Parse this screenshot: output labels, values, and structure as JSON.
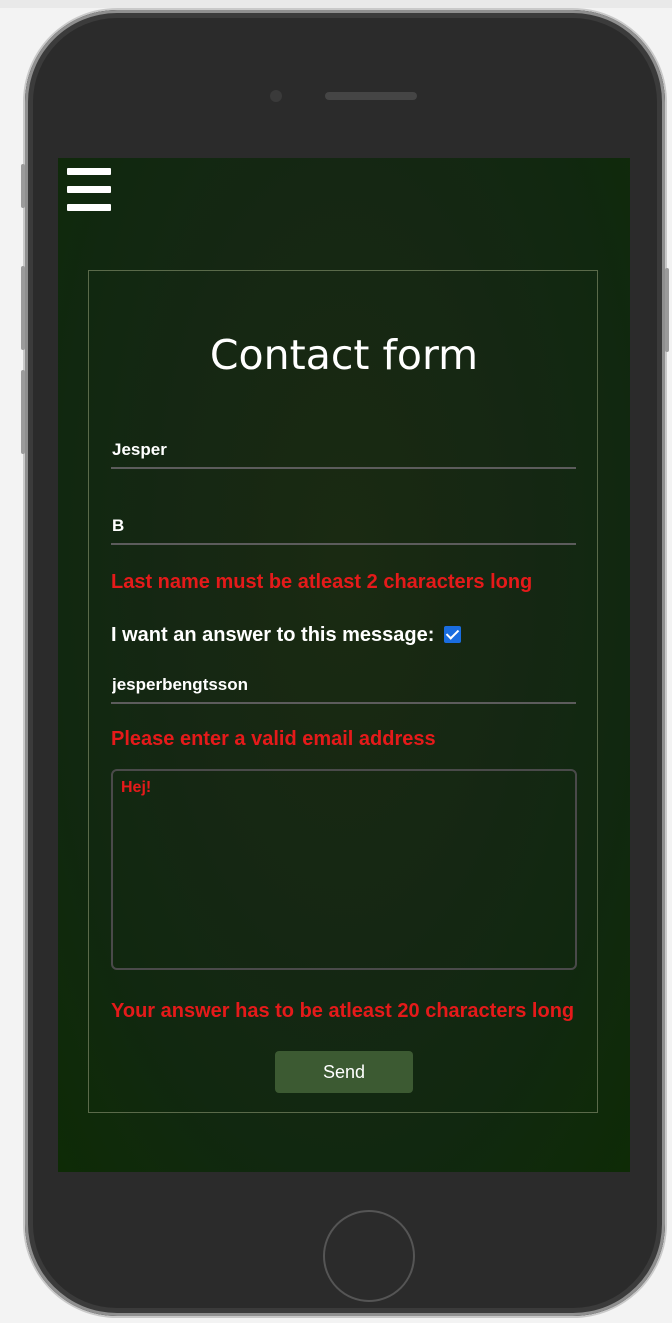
{
  "menu": {
    "icon": "hamburger-menu-icon"
  },
  "form": {
    "title": "Contact form",
    "first_name": {
      "value": "Jesper"
    },
    "last_name": {
      "value": "B",
      "error": "Last name must be atleast 2 characters long"
    },
    "answer_checkbox": {
      "label": "I want an answer to this message:",
      "checked": true
    },
    "email": {
      "value": "jesperbengtsson",
      "error": "Please enter a valid email address"
    },
    "message": {
      "value": "Hej!",
      "error": "Your answer has to be atleast 20 characters long"
    },
    "send_label": "Send"
  },
  "colors": {
    "error": "#e51a1a",
    "button": "#3c5a32",
    "checkbox": "#1a6de0",
    "screen_bg": "#152713"
  }
}
